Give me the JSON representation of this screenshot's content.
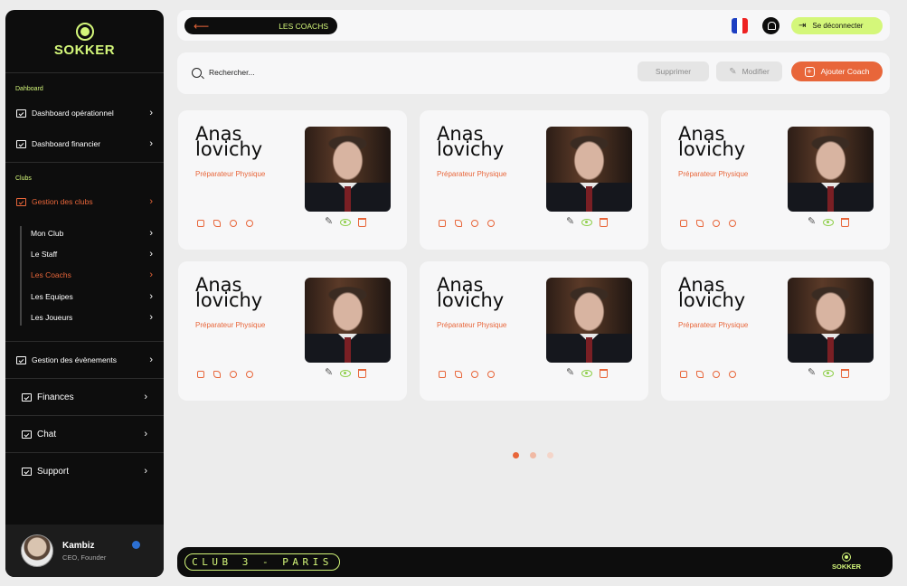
{
  "brand": {
    "name": "SOKKER",
    "accent": "#d4f77a",
    "orange": "#e8663a"
  },
  "sidebar": {
    "section_dashboard": "Dahboard",
    "dashboard_items": [
      {
        "label": "Dashboard opérationnel"
      },
      {
        "label": "Dashboard financier"
      }
    ],
    "section_clubs": "Clubs",
    "clubs_item": {
      "label": "Gestion des clubs"
    },
    "club_subitems": [
      {
        "label": "Mon Club"
      },
      {
        "label": "Le Staff"
      },
      {
        "label": "Les Coachs"
      },
      {
        "label": "Les Equipes"
      },
      {
        "label": "Les Joueurs"
      }
    ],
    "events_item": {
      "label": "Gestion des évènements"
    },
    "bottom_items": [
      {
        "label": "Finances"
      },
      {
        "label": "Chat"
      },
      {
        "label": "Support"
      }
    ],
    "user": {
      "name": "Kambiz",
      "role": "CEO, Founder"
    }
  },
  "header": {
    "back_title": "LES COACHS",
    "logout_label": "Se déconnecter"
  },
  "toolbar": {
    "search_placeholder": "Rechercher...",
    "delete_label": "Supprimer",
    "edit_label": "Modifier",
    "add_label": "Ajouter Coach"
  },
  "coaches": [
    {
      "first_name": "Anas",
      "last_name": "lovichy",
      "role": "Préparateur Physique"
    },
    {
      "first_name": "Anas",
      "last_name": "lovichy",
      "role": "Préparateur Physique"
    },
    {
      "first_name": "Anas",
      "last_name": "lovichy",
      "role": "Préparateur Physique"
    },
    {
      "first_name": "Anas",
      "last_name": "lovichy",
      "role": "Préparateur Physique"
    },
    {
      "first_name": "Anas",
      "last_name": "lovichy",
      "role": "Préparateur Physique"
    },
    {
      "first_name": "Anas",
      "last_name": "lovichy",
      "role": "Préparateur Physique"
    }
  ],
  "pagination": {
    "pages": 3,
    "current": 1
  },
  "footer": {
    "club_label": "CLUB 3 - PARIS",
    "logo_text": "SOKKER"
  }
}
